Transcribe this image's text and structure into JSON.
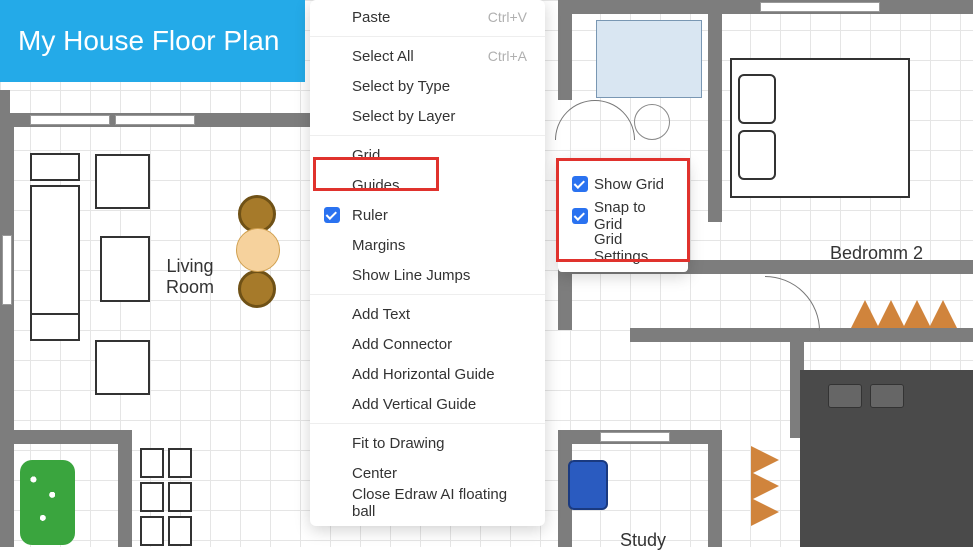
{
  "title": "My House Floor Plan",
  "rooms": {
    "living_room": "Living\nRoom",
    "bedroom2": "Bedromm 2",
    "study": "Study"
  },
  "context_menu": {
    "paste": {
      "label": "Paste",
      "shortcut": "Ctrl+V"
    },
    "select_all": {
      "label": "Select All",
      "shortcut": "Ctrl+A"
    },
    "select_by_type": "Select by Type",
    "select_by_layer": "Select by Layer",
    "grid": "Grid",
    "guides": "Guides",
    "ruler": "Ruler",
    "margins": "Margins",
    "show_line_jumps": "Show Line Jumps",
    "add_text": "Add Text",
    "add_connector": "Add Connector",
    "add_h_guide": "Add Horizontal Guide",
    "add_v_guide": "Add Vertical Guide",
    "fit_to_drawing": "Fit to Drawing",
    "center": "Center",
    "close_floating_ball": "Close Edraw AI floating ball"
  },
  "submenu": {
    "show_grid": "Show Grid",
    "snap_to_grid": "Snap to Grid",
    "grid_settings": "Grid Settings"
  }
}
